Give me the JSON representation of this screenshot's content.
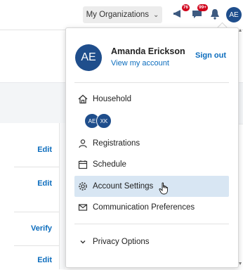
{
  "topbar": {
    "org_label": "My Organizations",
    "chevron_icon": "chevron-down-icon",
    "notif_badge_1": "76",
    "notif_badge_2": "99+",
    "avatar_initials": "AE"
  },
  "background": {
    "row_links": [
      "Edit",
      "Edit",
      "Verify",
      "Edit"
    ]
  },
  "menu": {
    "avatar_initials": "AE",
    "name": "Amanda Erickson",
    "view_account": "View my account",
    "sign_out": "Sign out",
    "household_label": "Household",
    "household_members": [
      "AE",
      "XK"
    ],
    "items": [
      {
        "label": "Registrations",
        "icon": "person-icon"
      },
      {
        "label": "Schedule",
        "icon": "calendar-icon"
      },
      {
        "label": "Account Settings",
        "icon": "gear-icon"
      },
      {
        "label": "Communication Preferences",
        "icon": "envelope-icon"
      }
    ],
    "privacy_label": "Privacy Options"
  },
  "colors": {
    "accent": "#1f4e8c",
    "link": "#0b6cbd",
    "hover": "#d8e6f3",
    "badge": "#d0021b"
  }
}
